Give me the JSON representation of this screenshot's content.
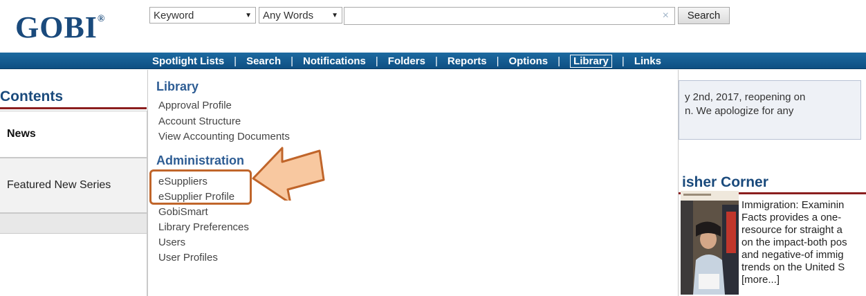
{
  "header": {
    "logo": "GOBI",
    "logo_mark": "®",
    "search_type_select": "Keyword",
    "match_select": "Any Words",
    "search_value": "",
    "clear_symbol": "×",
    "search_button": "Search"
  },
  "nav": {
    "items": [
      "Spotlight Lists",
      "Search",
      "Notifications",
      "Folders",
      "Reports",
      "Options",
      "Library",
      "Links"
    ],
    "separator": "|",
    "active": "Library"
  },
  "left": {
    "section_title": "Contents",
    "tabs": [
      "News",
      "Featured New Series",
      ""
    ]
  },
  "dropdown": {
    "library_heading": "Library",
    "library_items": [
      "Approval Profile",
      "Account Structure",
      "View Accounting Documents"
    ],
    "admin_heading": "Administration",
    "admin_items": [
      "eSuppliers",
      "eSupplier Profile",
      "GobiSmart",
      "Library Preferences",
      "Users",
      "User Profiles"
    ]
  },
  "right": {
    "notice_line1": "y 2nd, 2017, reopening on",
    "notice_line2": "n. We apologize for any",
    "publisher_title": "isher Corner",
    "publisher_text": [
      "Immigration: Examinin",
      "Facts provides a one-",
      "resource for straight a",
      "on the impact-both pos",
      "and negative-of immig",
      "trends on the United S",
      "[more...]"
    ]
  },
  "colors": {
    "brand": "#1a4a7c",
    "nav_bar": "#1d6aa0",
    "highlight": "#c0652a",
    "arrow_fill": "#f8c8a0",
    "rule_red": "#8b1e1e"
  }
}
